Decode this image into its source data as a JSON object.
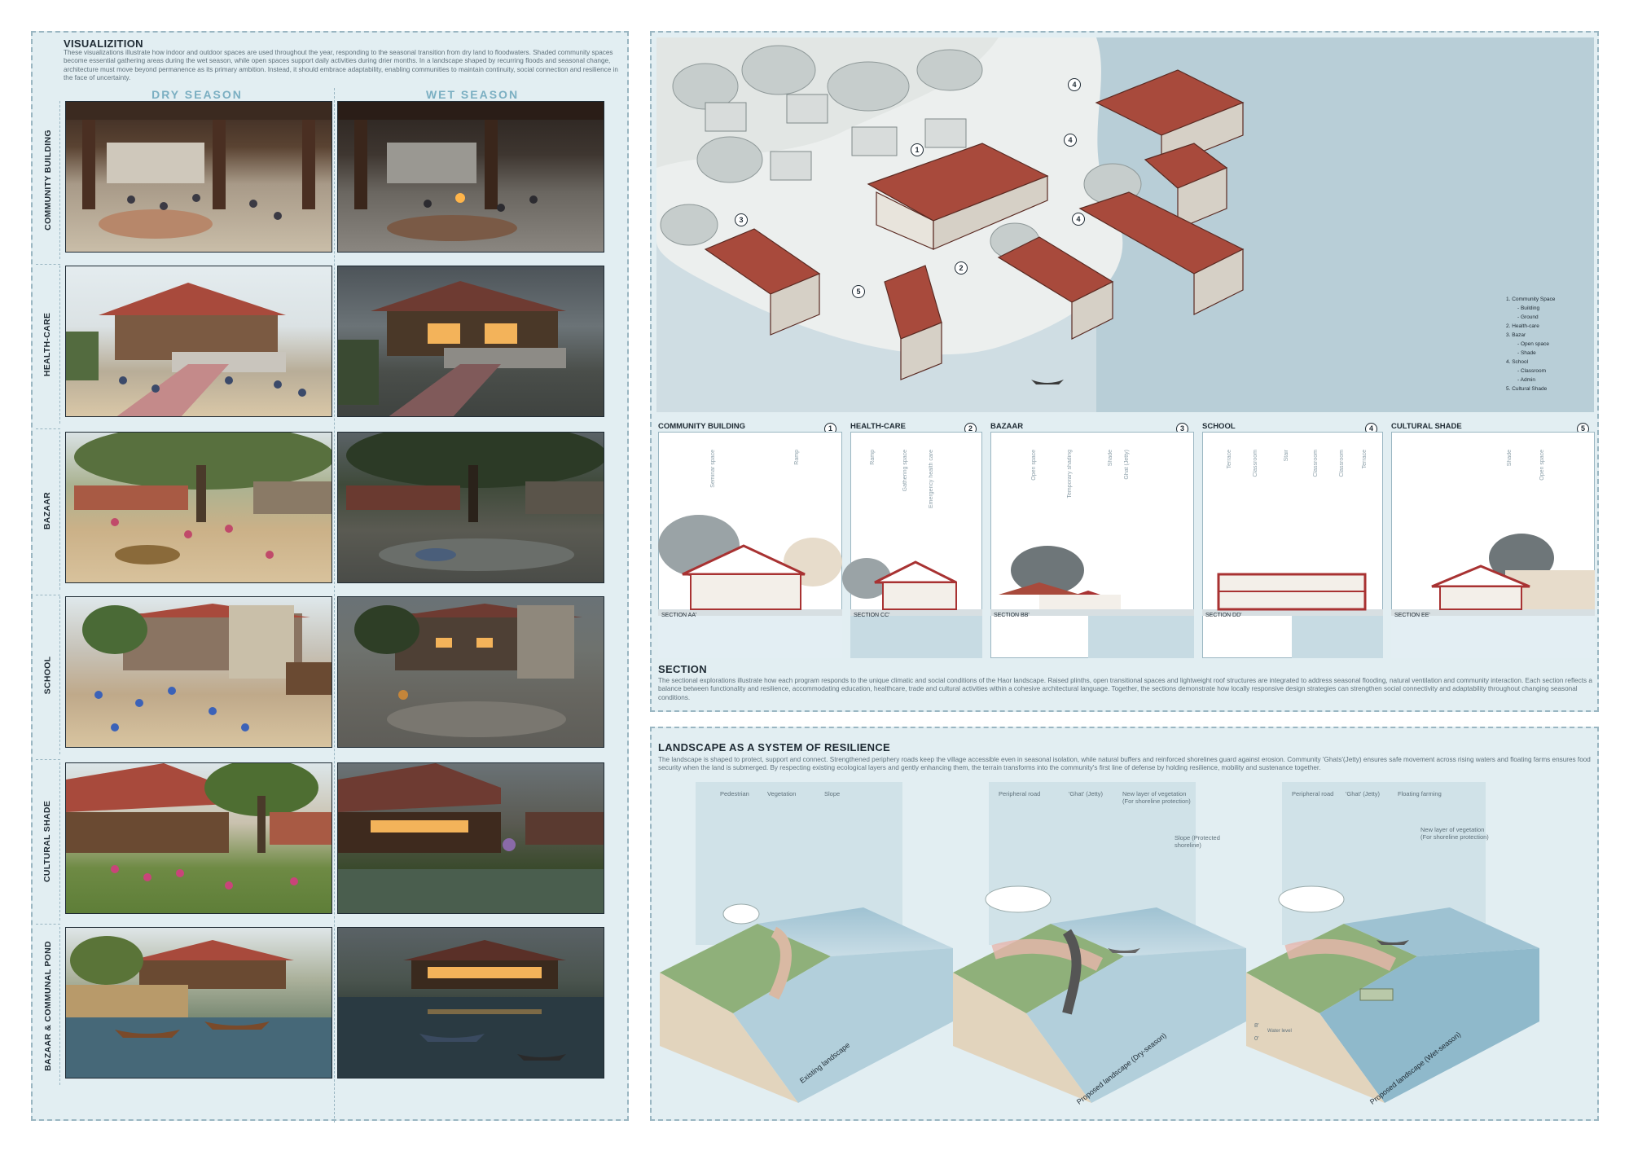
{
  "visualization": {
    "title": "VISUALIZITION",
    "description": "These visualizations illustrate how indoor and outdoor spaces are used throughout the year, responding to the seasonal transition from dry land to floodwaters. Shaded community spaces become essential gathering areas during the wet season, while open spaces support daily activities during drier months. In a landscape shaped by recurring floods and seasonal change, architecture must move beyond permanence as its primary ambition. Instead, it should embrace adaptability, enabling communities to maintain continuity, social connection and resilience in the face of uncertainty.",
    "season_dry": "DRY SEASON",
    "season_wet": "WET SEASON",
    "rows": [
      "COMMUNITY BUILDING",
      "HEALTH-CARE",
      "BAZAAR",
      "SCHOOL",
      "CULTURAL SHADE",
      "BAZAAR & COMMUNAL POND"
    ]
  },
  "site_plan": {
    "markers": [
      "1",
      "2",
      "3",
      "4",
      "4",
      "4",
      "5"
    ],
    "legend": [
      "1.  Community Space",
      "- Building",
      "- Ground",
      "2.  Health-care",
      "3.  Bazar",
      "- Open space",
      "- Shade",
      "4.  School",
      "- Classroom",
      "- Admin",
      "5.  Cultural Shade"
    ]
  },
  "sections": {
    "items": [
      {
        "title": "COMMUNITY BUILDING",
        "num": "1",
        "section": "SECTION AA'",
        "labels": [
          "Seminar space",
          "Ramp"
        ]
      },
      {
        "title": "HEALTH-CARE",
        "num": "2",
        "section": "SECTION CC'",
        "labels": [
          "Ramp",
          "Gathering space",
          "Emergency health care"
        ]
      },
      {
        "title": "BAZAAR",
        "num": "3",
        "section": "SECTION BB'",
        "labels": [
          "Open space",
          "Temporary shading",
          "Shade",
          "Ghat (Jetty)"
        ]
      },
      {
        "title": "SCHOOL",
        "num": "4",
        "section": "SECTION DD'",
        "labels": [
          "Terrace",
          "Classroom",
          "Stair",
          "Classroom",
          "Classroom",
          "Terrace"
        ]
      },
      {
        "title": "CULTURAL SHADE",
        "num": "5",
        "section": "SECTION EE'",
        "labels": [
          "Shade",
          "Open space"
        ]
      }
    ],
    "heading": "SECTION",
    "description": "The sectional explorations illustrate how each program responds to the unique climatic and social conditions of the Haor landscape. Raised plinths, open transitional spaces and lightweight roof structures are integrated to address seasonal flooding, natural ventilation and community interaction. Each section reflects a balance between functionality and resilience, accommodating education, healthcare, trade and cultural activities within a cohesive architectural language. Together, the sections demonstrate how locally responsive design strategies can strengthen social connectivity and adaptability throughout changing seasonal conditions."
  },
  "landscape": {
    "title": "LANDSCAPE AS A SYSTEM OF RESILIENCE",
    "description": "The landscape is shaped to protect, support and connect. Strengthened periphery roads keep the village accessible even in seasonal isolation, while natural buffers and reinforced shorelines guard against erosion. Community 'Ghats'(Jetty) ensures safe movement across rising waters and floating farms ensures food security when the land is submerged. By respecting existing ecological layers and gently enhancing them, the terrain transforms into the community's first line of defense by holding resilience, mobility and sustenance together.",
    "blocks": [
      {
        "caption": "Existing landscape",
        "labels": [
          "Pedestrian",
          "Vegetation",
          "Slope"
        ]
      },
      {
        "caption": "Proposed landscape (Dry-season)",
        "labels": [
          "Peripheral road",
          "'Ghat' (Jetty)",
          "New layer of vegetation (For shoreline protection)",
          "Slope (Protected shoreline)"
        ]
      },
      {
        "caption": "Proposed landscape (Wet-season)",
        "labels": [
          "Peripheral road",
          "'Ghat' (Jetty)",
          "Floating farming",
          "New layer of vegetation (For shoreline protection)"
        ],
        "levels": [
          "8'",
          "0'",
          "Water level"
        ]
      }
    ]
  },
  "colors": {
    "panel": "#e2eef2",
    "border": "#9ab6c2",
    "roof": "#a84a3c",
    "water": "#a9c7d3",
    "accent": "#7bafc2"
  }
}
